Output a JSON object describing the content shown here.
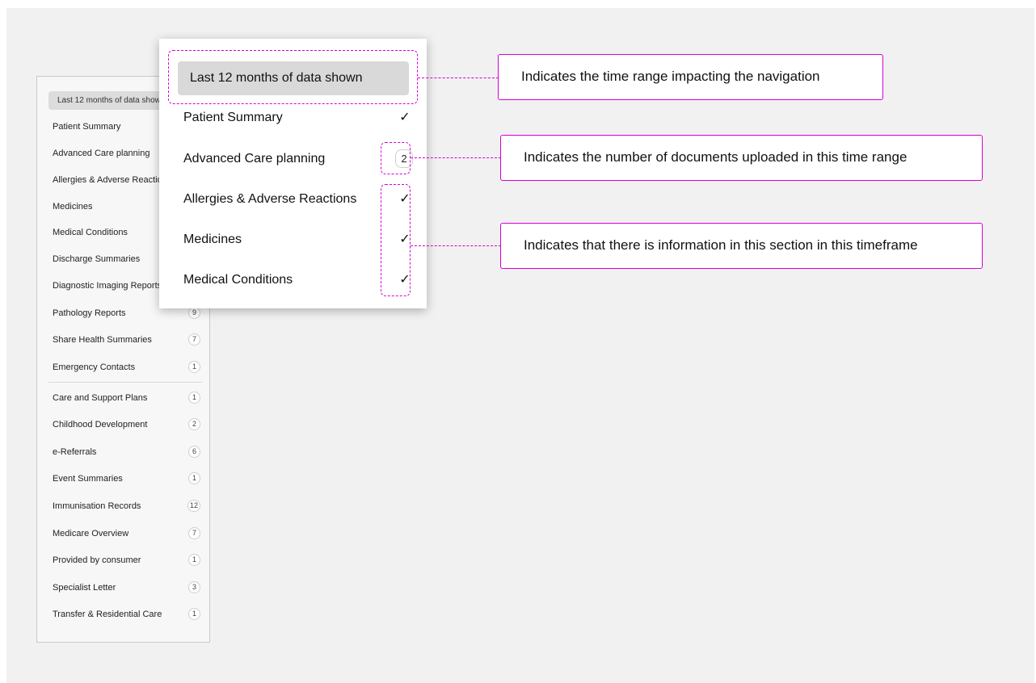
{
  "sidebar": {
    "range_label": "Last 12 months of data shown",
    "items": [
      {
        "label": "Patient Summary",
        "badge": ""
      },
      {
        "label": "Advanced Care planning",
        "badge": ""
      },
      {
        "label": "Allergies & Adverse Reactions",
        "badge": ""
      },
      {
        "label": "Medicines",
        "badge": ""
      },
      {
        "label": "Medical Conditions",
        "badge": ""
      },
      {
        "label": "Discharge Summaries",
        "badge": ""
      },
      {
        "label": "Diagnostic Imaging Reports",
        "badge": ""
      },
      {
        "label": "Pathology Reports",
        "badge": "9"
      },
      {
        "label": "Share Health Summaries",
        "badge": "7"
      },
      {
        "label": "Emergency Contacts",
        "badge": "1"
      },
      {
        "label": "Care and Support Plans",
        "badge": "1"
      },
      {
        "label": "Childhood Development",
        "badge": "2"
      },
      {
        "label": "e-Referrals",
        "badge": "6"
      },
      {
        "label": "Event Summaries",
        "badge": "1"
      },
      {
        "label": "Immunisation Records",
        "badge": "12"
      },
      {
        "label": "Medicare Overview",
        "badge": "7"
      },
      {
        "label": "Provided by consumer",
        "badge": "1"
      },
      {
        "label": "Specialist Letter",
        "badge": "3"
      },
      {
        "label": "Transfer & Residential Care",
        "badge": "1"
      }
    ]
  },
  "popup": {
    "range_label": "Last 12 months of data shown",
    "items": [
      {
        "label": "Patient Summary",
        "indicator": "check"
      },
      {
        "label": "Advanced Care planning",
        "indicator": "badge",
        "badge": "2"
      },
      {
        "label": "Allergies & Adverse Reactions",
        "indicator": "check"
      },
      {
        "label": "Medicines",
        "indicator": "check"
      },
      {
        "label": "Medical Conditions",
        "indicator": "check"
      }
    ],
    "check_glyph": "✓"
  },
  "callouts": {
    "time_range": "Indicates the time range impacting the navigation",
    "documents": "Indicates the number of documents uploaded in this time range",
    "information": "Indicates that there is information in this section in this timeframe"
  },
  "colors": {
    "annotation": "#d600d6",
    "background": "#f1f1f1"
  }
}
